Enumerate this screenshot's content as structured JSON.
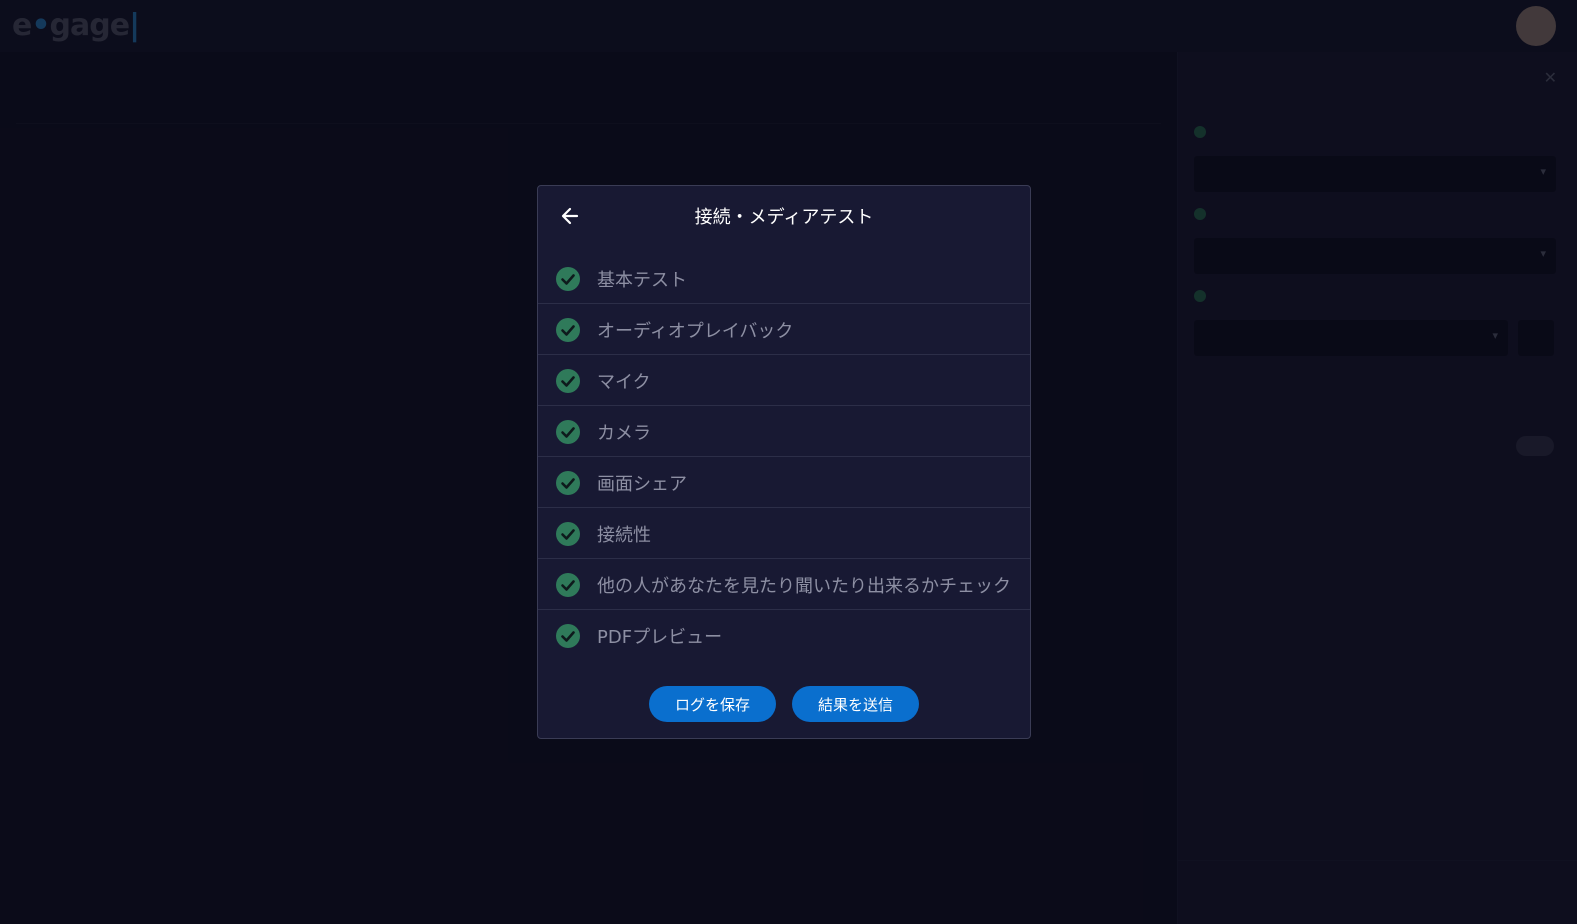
{
  "modal": {
    "title": "接続・メディアテスト",
    "tests": [
      {
        "label": "基本テスト",
        "status": "passed"
      },
      {
        "label": "オーディオプレイバック",
        "status": "passed"
      },
      {
        "label": "マイク",
        "status": "passed"
      },
      {
        "label": "カメラ",
        "status": "passed"
      },
      {
        "label": "画面シェア",
        "status": "passed"
      },
      {
        "label": "接続性",
        "status": "passed"
      },
      {
        "label": "他の人があなたを見たり聞いたり出来るかチェック",
        "status": "passed"
      },
      {
        "label": "PDFプレビュー",
        "status": "passed"
      }
    ],
    "save_log_label": "ログを保存",
    "send_results_label": "結果を送信"
  },
  "colors": {
    "accent": "#0a6fce",
    "check": "#2f7a5a",
    "modal_bg": "#181933"
  }
}
